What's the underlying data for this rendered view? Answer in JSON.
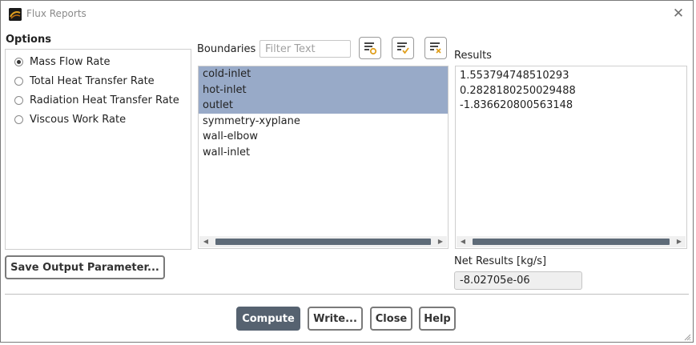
{
  "window": {
    "title": "Flux Reports",
    "close_glyph": "✕"
  },
  "options": {
    "label": "Options",
    "items": [
      {
        "label": "Mass Flow Rate",
        "checked": true
      },
      {
        "label": "Total Heat Transfer Rate",
        "checked": false
      },
      {
        "label": "Radiation Heat Transfer Rate",
        "checked": false
      },
      {
        "label": "Viscous Work Rate",
        "checked": false
      }
    ]
  },
  "boundaries": {
    "label": "Boundaries",
    "filter_placeholder": "Filter Text",
    "filter_value": "",
    "items": [
      {
        "label": "cold-inlet",
        "selected": true
      },
      {
        "label": "hot-inlet",
        "selected": true
      },
      {
        "label": "outlet",
        "selected": true
      },
      {
        "label": "symmetry-xyplane",
        "selected": false
      },
      {
        "label": "wall-elbow",
        "selected": false
      },
      {
        "label": "wall-inlet",
        "selected": false
      }
    ],
    "toolbar": [
      {
        "icon": "filter-select-icon"
      },
      {
        "icon": "select-all-icon"
      },
      {
        "icon": "deselect-all-icon"
      }
    ]
  },
  "results": {
    "label": "Results",
    "values": [
      "1.553794748510293",
      "0.2828180250029488",
      "-1.836620800563148"
    ]
  },
  "net_results": {
    "label": "Net Results [kg/s]",
    "value": "-8.02705e-06"
  },
  "buttons": {
    "save_output_parameter": "Save Output Parameter...",
    "compute": "Compute",
    "write": "Write...",
    "close": "Close",
    "help": "Help"
  },
  "colors": {
    "selection": "#98aac8",
    "primary_button": "#566270",
    "icon_accent": "#e0a020"
  }
}
